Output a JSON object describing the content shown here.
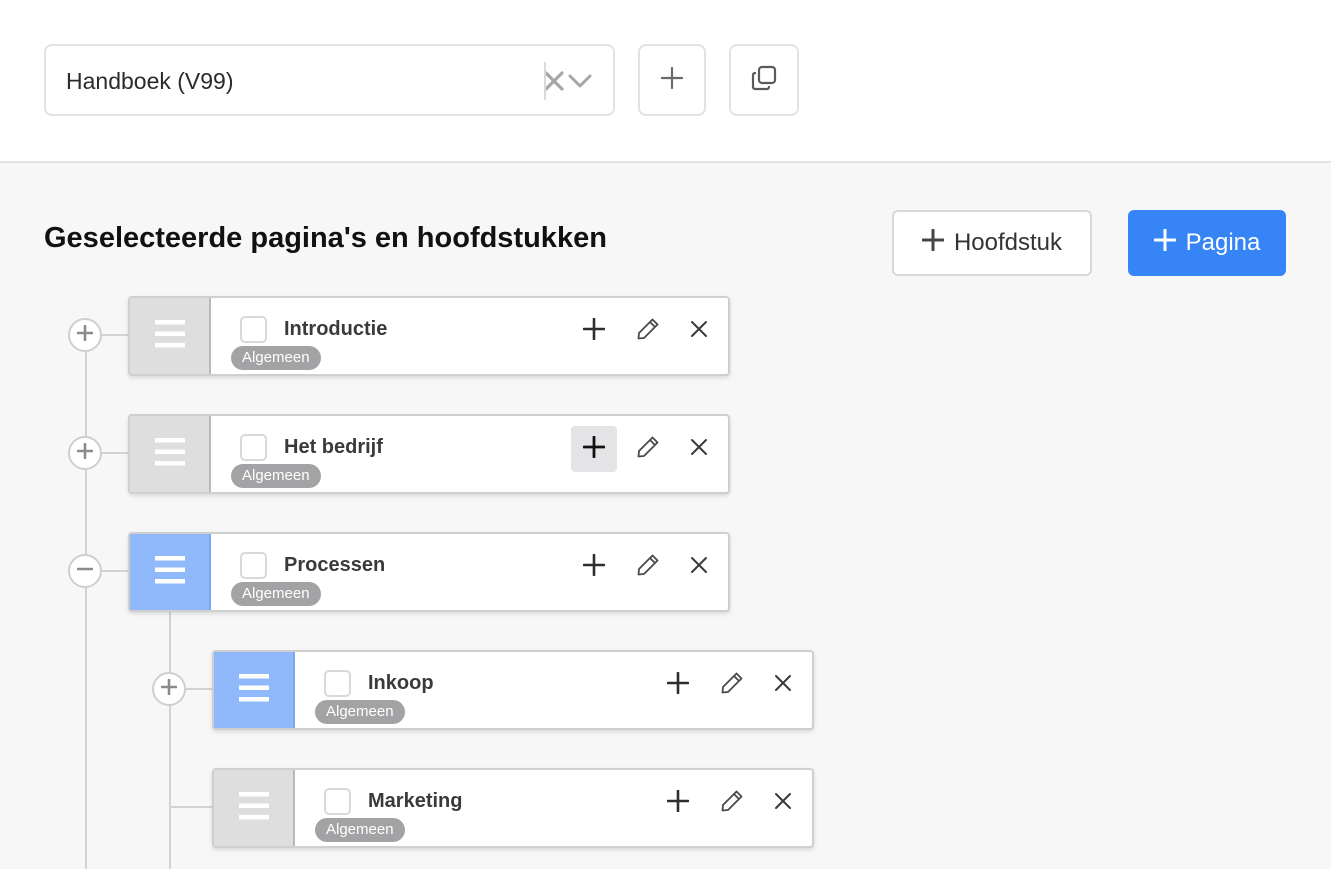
{
  "selector": {
    "value": "Handboek (V99)",
    "clear_icon": "close-icon",
    "dropdown_icon": "chevron-down-icon"
  },
  "toolbar": {
    "add_icon": "plus-icon",
    "duplicate_icon": "copy-icon"
  },
  "section": {
    "title": "Geselecteerde pagina's en hoofdstukken",
    "add_chapter_label": "Hoofdstuk",
    "add_page_label": "Pagina"
  },
  "colors": {
    "accent": "#3784f6",
    "active_handle": "#90b9fc",
    "inactive_handle": "#dedede",
    "badge": "#a3a3a5"
  },
  "tree": {
    "items": [
      {
        "title": "Introductie",
        "tag": "Algemeen",
        "level": 0,
        "expanded": false,
        "active": false
      },
      {
        "title": "Het bedrijf",
        "tag": "Algemeen",
        "level": 0,
        "expanded": false,
        "active": false
      },
      {
        "title": "Processen",
        "tag": "Algemeen",
        "level": 0,
        "expanded": true,
        "active": true
      },
      {
        "title": "Inkoop",
        "tag": "Algemeen",
        "level": 1,
        "expanded": false,
        "active": true
      },
      {
        "title": "Marketing",
        "tag": "Algemeen",
        "level": 1,
        "expanded": null,
        "active": false
      }
    ]
  }
}
